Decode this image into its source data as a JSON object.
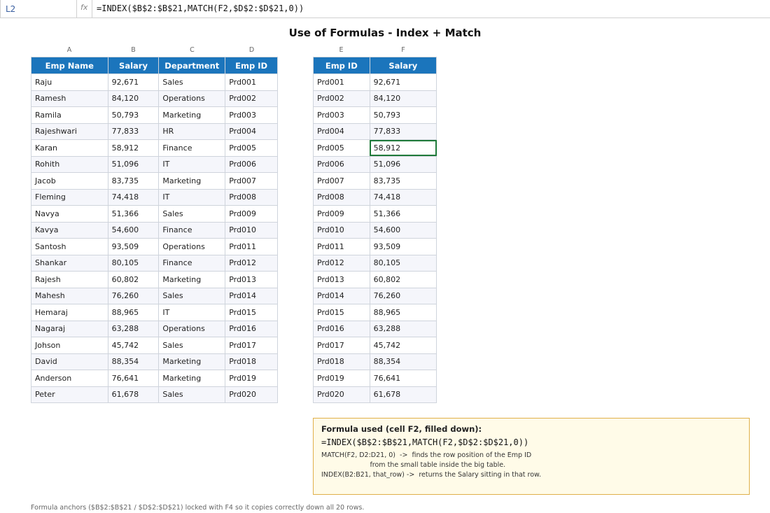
{
  "formula_bar": {
    "cell_ref": "L2",
    "fx_label": "fx",
    "formula": "=INDEX($B$2:$B$21,MATCH(F2,$D$2:$D$21,0))"
  },
  "title": "Use of Formulas - Index + Match",
  "main_table": {
    "col_letters": [
      "A",
      "B",
      "C",
      "D"
    ],
    "headers": [
      "Emp Name",
      "Salary",
      "Department",
      "Emp ID"
    ],
    "rows": [
      [
        "Raju",
        "92,671",
        "Sales",
        "Prd001"
      ],
      [
        "Ramesh",
        "84,120",
        "Operations",
        "Prd002"
      ],
      [
        "Ramila",
        "50,793",
        "Marketing",
        "Prd003"
      ],
      [
        "Rajeshwari",
        "77,833",
        "HR",
        "Prd004"
      ],
      [
        "Karan",
        "58,912",
        "Finance",
        "Prd005"
      ],
      [
        "Rohith",
        "51,096",
        "IT",
        "Prd006"
      ],
      [
        "Jacob",
        "83,735",
        "Marketing",
        "Prd007"
      ],
      [
        "Fleming",
        "74,418",
        "IT",
        "Prd008"
      ],
      [
        "Navya",
        "51,366",
        "Sales",
        "Prd009"
      ],
      [
        "Kavya",
        "54,600",
        "Finance",
        "Prd010"
      ],
      [
        "Santosh",
        "93,509",
        "Operations",
        "Prd011"
      ],
      [
        "Shankar",
        "80,105",
        "Finance",
        "Prd012"
      ],
      [
        "Rajesh",
        "60,802",
        "Marketing",
        "Prd013"
      ],
      [
        "Mahesh",
        "76,260",
        "Sales",
        "Prd014"
      ],
      [
        "Hemaraj",
        "88,965",
        "IT",
        "Prd015"
      ],
      [
        "Nagaraj",
        "63,288",
        "Operations",
        "Prd016"
      ],
      [
        "Johson",
        "45,742",
        "Sales",
        "Prd017"
      ],
      [
        "David",
        "88,354",
        "Marketing",
        "Prd018"
      ],
      [
        "Anderson",
        "76,641",
        "Marketing",
        "Prd019"
      ],
      [
        "Peter",
        "61,678",
        "Sales",
        "Prd020"
      ]
    ]
  },
  "lookup_table": {
    "col_letters": [
      "E",
      "F"
    ],
    "headers": [
      "Emp ID",
      "Salary"
    ],
    "selected_row": 4,
    "rows": [
      [
        "Prd001",
        "92,671"
      ],
      [
        "Prd002",
        "84,120"
      ],
      [
        "Prd003",
        "50,793"
      ],
      [
        "Prd004",
        "77,833"
      ],
      [
        "Prd005",
        "58,912"
      ],
      [
        "Prd006",
        "51,096"
      ],
      [
        "Prd007",
        "83,735"
      ],
      [
        "Prd008",
        "74,418"
      ],
      [
        "Prd009",
        "51,366"
      ],
      [
        "Prd010",
        "54,600"
      ],
      [
        "Prd011",
        "93,509"
      ],
      [
        "Prd012",
        "80,105"
      ],
      [
        "Prd013",
        "60,802"
      ],
      [
        "Prd014",
        "76,260"
      ],
      [
        "Prd015",
        "88,965"
      ],
      [
        "Prd016",
        "63,288"
      ],
      [
        "Prd017",
        "45,742"
      ],
      [
        "Prd018",
        "88,354"
      ],
      [
        "Prd019",
        "76,641"
      ],
      [
        "Prd020",
        "61,678"
      ]
    ]
  },
  "formula_note": {
    "title": "Formula used (cell F2, filled down):",
    "formula": "=INDEX($B$2:$B$21,MATCH(F2,$D$2:$D$21,0))",
    "line1": "MATCH(F2, D2:D21, 0)  ->  finds the row position of the Emp ID",
    "line2": "                       from the small table inside the big table.",
    "line3": "INDEX(B2:B21, that_row) ->  returns the Salary sitting in that row."
  },
  "footnote": "Formula anchors ($B$2:$B$21 / $D$2:$D$21) locked with F4 so it copies correctly down all 20 rows.",
  "colors": {
    "header_bg": "#1b75bc",
    "selection": "#1f7a3a",
    "note_bg": "#fffbe8",
    "note_border": "#e0b04a"
  }
}
